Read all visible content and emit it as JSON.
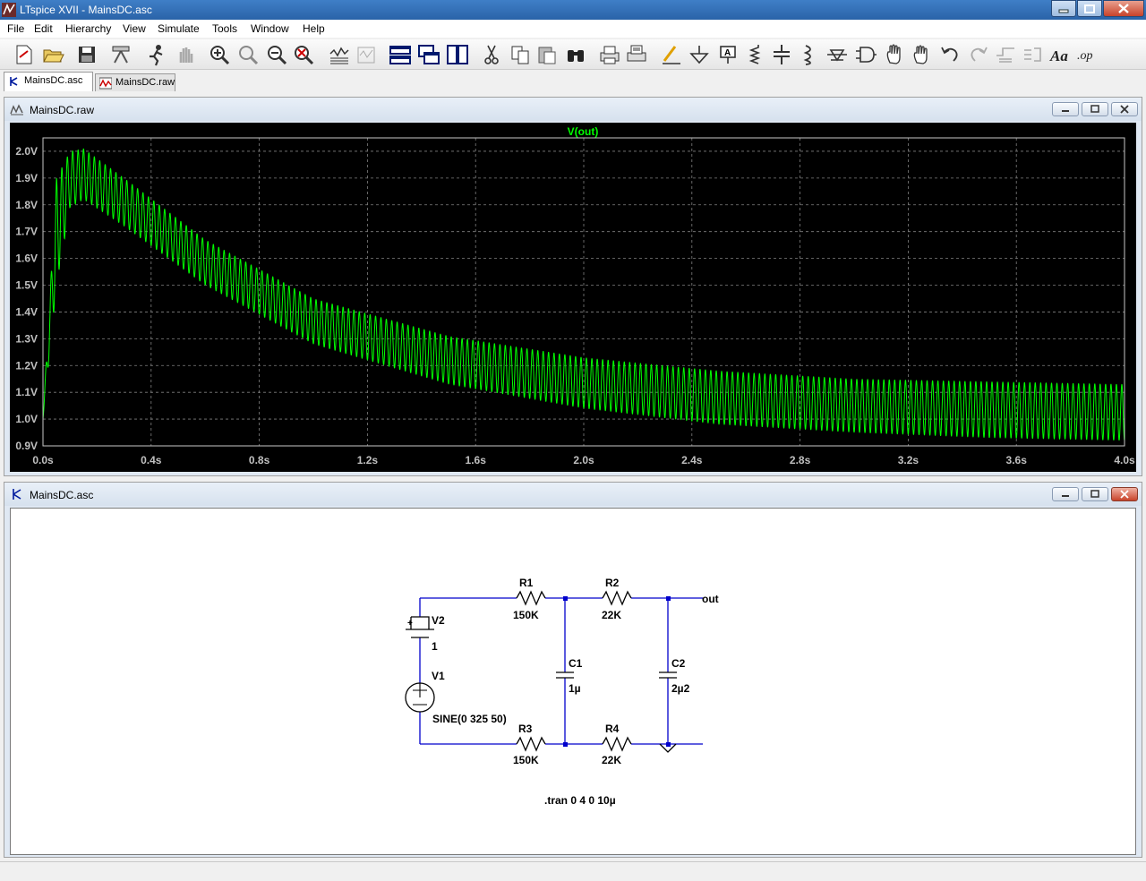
{
  "window": {
    "title": "LTspice XVII - MainsDC.asc"
  },
  "menu": [
    "File",
    "Edit",
    "Hierarchy",
    "View",
    "Simulate",
    "Tools",
    "Window",
    "Help"
  ],
  "toolbar_icons": [
    "new-schematic-icon",
    "open-icon",
    "save-icon",
    "control-panel-icon",
    "run-icon",
    "halt-icon",
    "zoom-in-icon",
    "zoom-out-icon",
    "zoom-fit-icon",
    "zoom-cancel-icon",
    "autorange-icon",
    "manual-limits-icon",
    "tile-horizontal-icon",
    "cascade-icon",
    "tile-vertical-icon",
    "cut-icon",
    "copy-icon",
    "paste-icon",
    "find-icon",
    "print-icon",
    "print-setup-icon",
    "draw-wire-icon",
    "ground-icon",
    "label-net-icon",
    "resistor-icon",
    "capacitor-icon",
    "inductor-icon",
    "diode-icon",
    "component-icon",
    "move-icon",
    "drag-icon",
    "undo-icon",
    "redo-icon",
    "rotate-icon",
    "mirror-icon",
    "text-icon",
    "spice-directive-icon"
  ],
  "tabs": [
    {
      "label": "MainsDC.asc",
      "active": true
    },
    {
      "label": "MainsDC.raw",
      "active": false
    }
  ],
  "waveform_window": {
    "title": "MainsDC.raw",
    "trace_name": "V(out)",
    "trace_color": "#00ff00"
  },
  "chart_data": {
    "type": "line",
    "title": "V(out)",
    "xlabel": "",
    "ylabel": "",
    "xlim": [
      0,
      4
    ],
    "ylim": [
      0.9,
      2.05
    ],
    "x_ticks": [
      "0.0s",
      "0.4s",
      "0.8s",
      "1.2s",
      "1.6s",
      "2.0s",
      "2.4s",
      "2.8s",
      "3.2s",
      "3.6s",
      "4.0s"
    ],
    "y_ticks": [
      "2.0V",
      "1.9V",
      "1.8V",
      "1.7V",
      "1.6V",
      "1.5V",
      "1.4V",
      "1.3V",
      "1.2V",
      "1.1V",
      "1.0V",
      "0.9V"
    ],
    "grid": true,
    "series": [
      {
        "name": "V(out)",
        "ripple_hz": 50,
        "envelope_upper": {
          "t": [
            0,
            0.05,
            0.1,
            0.15,
            0.3,
            0.6,
            1.0,
            1.5,
            2.0,
            2.5,
            3.0,
            3.5,
            4.0
          ],
          "v": [
            1.0,
            1.9,
            2.0,
            2.01,
            1.9,
            1.67,
            1.45,
            1.31,
            1.23,
            1.18,
            1.15,
            1.14,
            1.13
          ]
        },
        "envelope_lower": {
          "t": [
            0,
            0.05,
            0.1,
            0.15,
            0.3,
            0.6,
            1.0,
            1.5,
            2.0,
            2.5,
            3.0,
            3.5,
            4.0
          ],
          "v": [
            1.0,
            1.5,
            1.79,
            1.82,
            1.72,
            1.5,
            1.28,
            1.13,
            1.04,
            0.98,
            0.95,
            0.93,
            0.92
          ]
        }
      }
    ]
  },
  "schematic_window": {
    "title": "MainsDC.asc",
    "components": {
      "R1": {
        "name": "R1",
        "value": "150K"
      },
      "R2": {
        "name": "R2",
        "value": "22K"
      },
      "R3": {
        "name": "R3",
        "value": "150K"
      },
      "R4": {
        "name": "R4",
        "value": "22K"
      },
      "C1": {
        "name": "C1",
        "value": "1µ"
      },
      "C2": {
        "name": "C2",
        "value": "2µ2"
      },
      "V1": {
        "name": "V1",
        "value": "SINE(0 325 50)"
      },
      "V2": {
        "name": "V2",
        "value": "1"
      }
    },
    "net_label": "out",
    "v2_plus": "+",
    "directive": ".tran 0 4 0 10µ"
  }
}
